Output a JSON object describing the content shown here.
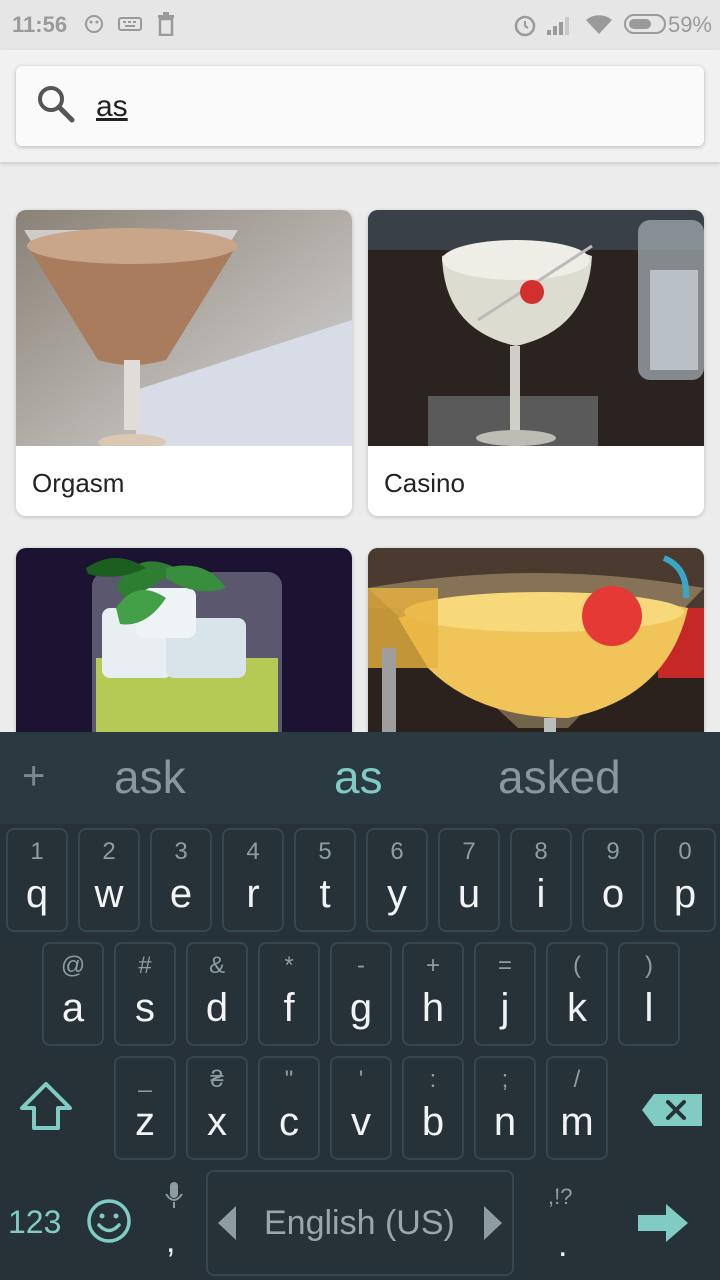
{
  "status": {
    "time": "11:56",
    "battery": "59%"
  },
  "search": {
    "query": "as"
  },
  "cards": [
    {
      "title": "Orgasm"
    },
    {
      "title": "Casino"
    },
    {
      "title": ""
    },
    {
      "title": ""
    }
  ],
  "keyboard": {
    "suggestions": {
      "add": "+",
      "left": "ask",
      "center": "as",
      "right": "asked"
    },
    "row1": [
      {
        "alt": "1",
        "key": "q"
      },
      {
        "alt": "2",
        "key": "w"
      },
      {
        "alt": "3",
        "key": "e"
      },
      {
        "alt": "4",
        "key": "r"
      },
      {
        "alt": "5",
        "key": "t"
      },
      {
        "alt": "6",
        "key": "y"
      },
      {
        "alt": "7",
        "key": "u"
      },
      {
        "alt": "8",
        "key": "i"
      },
      {
        "alt": "9",
        "key": "o"
      },
      {
        "alt": "0",
        "key": "p"
      }
    ],
    "row2": [
      {
        "alt": "@",
        "key": "a"
      },
      {
        "alt": "#",
        "key": "s"
      },
      {
        "alt": "&",
        "key": "d"
      },
      {
        "alt": "*",
        "key": "f"
      },
      {
        "alt": "-",
        "key": "g"
      },
      {
        "alt": "+",
        "key": "h"
      },
      {
        "alt": "=",
        "key": "j"
      },
      {
        "alt": "(",
        "key": "k"
      },
      {
        "alt": ")",
        "key": "l"
      }
    ],
    "row3": [
      {
        "alt": "_",
        "key": "z"
      },
      {
        "alt": "₴",
        "key": "x"
      },
      {
        "alt": "\"",
        "key": "c"
      },
      {
        "alt": "'",
        "key": "v"
      },
      {
        "alt": ":",
        "key": "b"
      },
      {
        "alt": ";",
        "key": "n"
      },
      {
        "alt": "/",
        "key": "m"
      }
    ],
    "bottom": {
      "numbers": "123",
      "comma": ",",
      "space": "English (US)",
      "punct_alt": ",!?",
      "period": "."
    },
    "accent": "#80cbc4"
  }
}
